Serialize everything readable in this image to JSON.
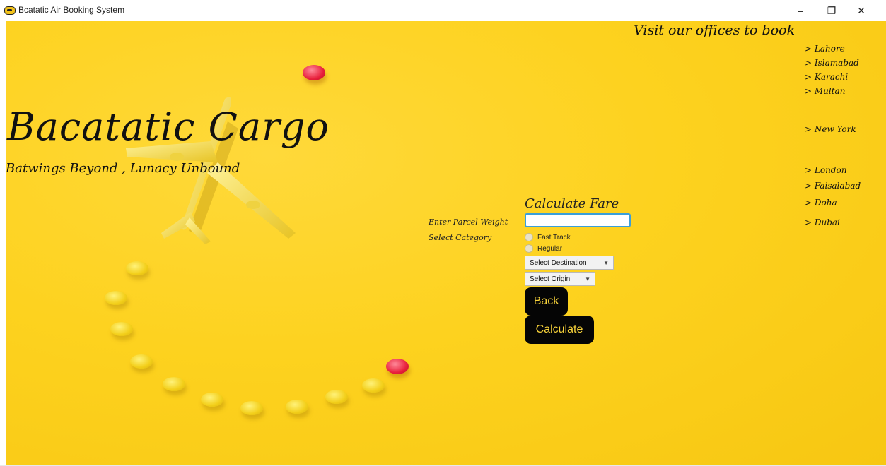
{
  "window": {
    "title": "Bcatatic Air Booking System",
    "minimize_glyph": "–",
    "restore_glyph": "❐",
    "close_glyph": "✕"
  },
  "brand": {
    "title": "Bacatatic Cargo",
    "tagline": "Batwings Beyond , Lunacy Unbound"
  },
  "offices": {
    "heading": "Visit our offices to book",
    "cities": [
      "> Lahore",
      "> Islamabad",
      "> Karachi",
      "> Multan",
      "> New York",
      "> London",
      "> Faisalabad",
      "> Doha",
      "> Dubai"
    ]
  },
  "form": {
    "heading": "Calculate Fare",
    "weight_label": "Enter Parcel Weight",
    "weight_value": "",
    "category_label": "Select Category",
    "category_options": [
      "Fast Track",
      "Regular"
    ],
    "destination_combo": "Select Destination",
    "origin_combo": "Select Origin",
    "back_button": "Back",
    "calculate_button": "Calculate"
  },
  "colors": {
    "background": "#fdd21f",
    "button_bg": "#050505",
    "button_text": "#f7d23a",
    "input_focus": "#3b9fd8"
  },
  "icons": [
    "app-icon",
    "minimize-icon",
    "restore-icon",
    "close-icon",
    "chevron-down-icon"
  ]
}
